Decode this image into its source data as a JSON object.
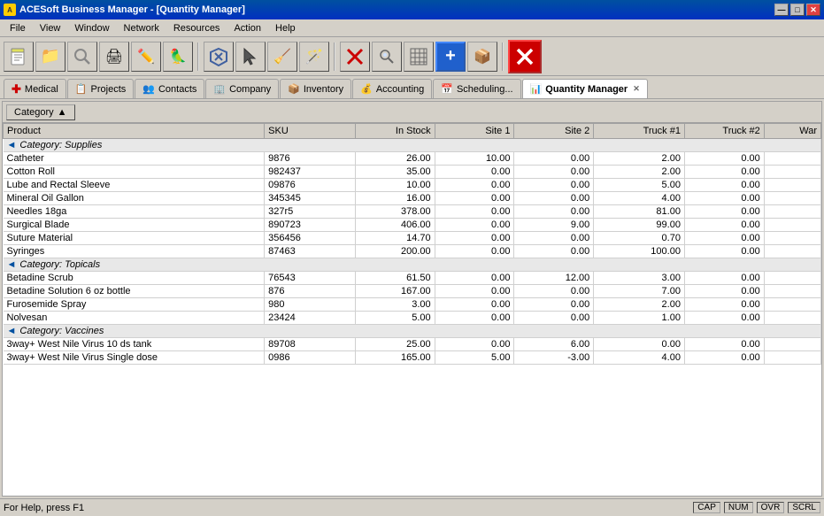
{
  "window": {
    "title": "ACESoft Business Manager - [Quantity Manager]",
    "title_buttons": [
      "—",
      "□",
      "✕"
    ]
  },
  "menu": {
    "items": [
      "File",
      "View",
      "Window",
      "Network",
      "Resources",
      "Action",
      "Help"
    ]
  },
  "toolbar": {
    "buttons": [
      {
        "name": "new",
        "icon": "📄"
      },
      {
        "name": "open",
        "icon": "📁"
      },
      {
        "name": "search",
        "icon": "🔍"
      },
      {
        "name": "print",
        "icon": "🖨"
      },
      {
        "name": "edit",
        "icon": "✏️"
      },
      {
        "name": "user",
        "icon": "👤"
      },
      {
        "name": "cursor",
        "icon": "↖"
      },
      {
        "name": "broom",
        "icon": "🧹"
      },
      {
        "name": "wizard",
        "icon": "🪄"
      },
      {
        "name": "delete-red",
        "icon": "✕"
      },
      {
        "name": "find",
        "icon": "🔎"
      },
      {
        "name": "filter",
        "icon": "▦"
      },
      {
        "name": "add-blue",
        "icon": "+"
      },
      {
        "name": "box-green",
        "icon": "📦"
      },
      {
        "name": "close-red",
        "icon": "✕"
      }
    ]
  },
  "tabs": [
    {
      "id": "medical",
      "label": "Medical",
      "icon": "➕",
      "active": false,
      "closeable": false
    },
    {
      "id": "projects",
      "label": "Projects",
      "icon": "📋",
      "active": false,
      "closeable": false
    },
    {
      "id": "contacts",
      "label": "Contacts",
      "icon": "👥",
      "active": false,
      "closeable": false
    },
    {
      "id": "company",
      "label": "Company",
      "icon": "🏢",
      "active": false,
      "closeable": false
    },
    {
      "id": "inventory",
      "label": "Inventory",
      "icon": "📦",
      "active": false,
      "closeable": false
    },
    {
      "id": "accounting",
      "label": "Accounting",
      "icon": "💰",
      "active": false,
      "closeable": false
    },
    {
      "id": "scheduling",
      "label": "Scheduling...",
      "icon": "📅",
      "active": false,
      "closeable": false
    },
    {
      "id": "quantity-manager",
      "label": "Quantity Manager",
      "icon": "📊",
      "active": true,
      "closeable": true
    }
  ],
  "sort_bar": {
    "button_label": "Category",
    "sort_icon": "▲"
  },
  "table": {
    "headers": [
      "Product",
      "SKU",
      "In Stock",
      "Site 1",
      "Site 2",
      "Truck #1",
      "Truck #2",
      "War"
    ],
    "categories": [
      {
        "name": "Category: Supplies",
        "rows": [
          {
            "product": "Catheter",
            "sku": "9876",
            "in_stock": "26.00",
            "site1": "10.00",
            "site2": "0.00",
            "truck1": "2.00",
            "truck2": "0.00"
          },
          {
            "product": "Cotton Roll",
            "sku": "982437",
            "in_stock": "35.00",
            "site1": "0.00",
            "site2": "0.00",
            "truck1": "2.00",
            "truck2": "0.00"
          },
          {
            "product": "Lube and Rectal Sleeve",
            "sku": "09876",
            "in_stock": "10.00",
            "site1": "0.00",
            "site2": "0.00",
            "truck1": "5.00",
            "truck2": "0.00"
          },
          {
            "product": "Mineral Oil Gallon",
            "sku": "345345",
            "in_stock": "16.00",
            "site1": "0.00",
            "site2": "0.00",
            "truck1": "4.00",
            "truck2": "0.00"
          },
          {
            "product": "Needles 18ga",
            "sku": "327r5",
            "in_stock": "378.00",
            "site1": "0.00",
            "site2": "0.00",
            "truck1": "81.00",
            "truck2": "0.00"
          },
          {
            "product": "Surgical Blade",
            "sku": "890723",
            "in_stock": "406.00",
            "site1": "0.00",
            "site2": "9.00",
            "truck1": "99.00",
            "truck2": "0.00"
          },
          {
            "product": "Suture Material",
            "sku": "356456",
            "in_stock": "14.70",
            "site1": "0.00",
            "site2": "0.00",
            "truck1": "0.70",
            "truck2": "0.00"
          },
          {
            "product": "Syringes",
            "sku": "87463",
            "in_stock": "200.00",
            "site1": "0.00",
            "site2": "0.00",
            "truck1": "100.00",
            "truck2": "0.00"
          }
        ]
      },
      {
        "name": "Category: Topicals",
        "rows": [
          {
            "product": "Betadine Scrub",
            "sku": "76543",
            "in_stock": "61.50",
            "site1": "0.00",
            "site2": "12.00",
            "truck1": "3.00",
            "truck2": "0.00"
          },
          {
            "product": "Betadine Solution 6 oz bottle",
            "sku": "876",
            "in_stock": "167.00",
            "site1": "0.00",
            "site2": "0.00",
            "truck1": "7.00",
            "truck2": "0.00"
          },
          {
            "product": "Furosemide Spray",
            "sku": "980",
            "in_stock": "3.00",
            "site1": "0.00",
            "site2": "0.00",
            "truck1": "2.00",
            "truck2": "0.00"
          },
          {
            "product": "Nolvesan",
            "sku": "23424",
            "in_stock": "5.00",
            "site1": "0.00",
            "site2": "0.00",
            "truck1": "1.00",
            "truck2": "0.00"
          }
        ]
      },
      {
        "name": "Category: Vaccines",
        "rows": [
          {
            "product": "3way+ West Nile Virus 10 ds tank",
            "sku": "89708",
            "in_stock": "25.00",
            "site1": "0.00",
            "site2": "6.00",
            "truck1": "0.00",
            "truck2": "0.00"
          },
          {
            "product": "3way+ West Nile Virus Single dose",
            "sku": "0986",
            "in_stock": "165.00",
            "site1": "5.00",
            "site2": "-3.00",
            "truck1": "4.00",
            "truck2": "0.00"
          }
        ]
      }
    ]
  },
  "status": {
    "help_text": "For Help, press F1",
    "indicators": [
      "CAP",
      "NUM",
      "OVR",
      "SCRL"
    ]
  }
}
